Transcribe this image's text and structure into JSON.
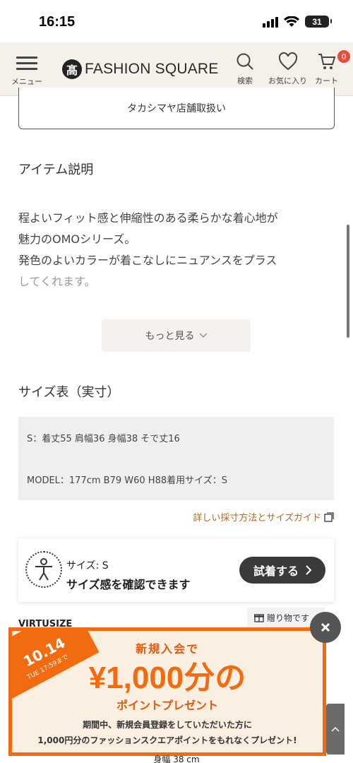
{
  "status_bar": {
    "time": "16:15",
    "battery": "31"
  },
  "header": {
    "menu_label": "メニュー",
    "logo_mark": "髙",
    "logo_text": "FASHION SQUARE",
    "search_label": "検索",
    "favorites_label": "お気に入り",
    "cart_label": "カート",
    "cart_count": "0"
  },
  "content": {
    "store_button": "タカシマヤ店舗取扱い",
    "item_description_title": "アイテム説明",
    "description_lines": [
      "程よいフィット感と伸縮性のある柔らかな着心地が",
      "魅力のOMOシリーズ。",
      "発色のよいカラーが着こなしにニュアンスをプラス",
      "してくれます。"
    ],
    "more_button": "もっと見る",
    "size_table_title": "サイズ表（実寸）",
    "size_row_1": "S：着丈55 肩幅36 身幅38 そで丈16",
    "size_row_2": "MODEL：177cm B79 W60 H88着用サイズ：S",
    "size_guide_link": "詳しい採寸方法とサイズガイド"
  },
  "virtusize": {
    "size_text": "サイズ: S",
    "message": "サイズ感を確認できます",
    "try_button": "試着する",
    "logo_text": "VIRTUSIZE"
  },
  "gift_tab_label": "贈り物です",
  "promo": {
    "date": "10.14",
    "until": "TUE 17:59まで",
    "headline": "新規入会で",
    "amount": "¥1,000分の",
    "subline": "ポイントプレゼント",
    "note_1": "期間中、新規会員登録をしていただいた方に",
    "note_2": "1,000円分のファッションスクエアポイントをもれなくプレゼント!"
  },
  "bottom_text": "身幅 38 cm",
  "colors": {
    "accent_orange": "#f26b10",
    "link_brown": "#a86a2c",
    "header_bg": "#f4f0ea"
  }
}
